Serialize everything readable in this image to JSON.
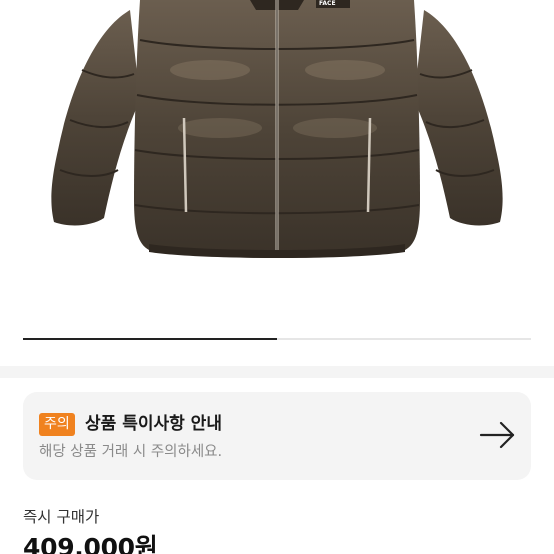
{
  "product": {
    "image_icon": "puffer-jacket-photo",
    "brand_logo_text": "FACE",
    "carousel_progress": 0.5
  },
  "notice": {
    "badge": "주의",
    "title": "상품 특이사항 안내",
    "description": "해당 상품 거래 시 주의하세요.",
    "arrow_icon": "arrow-right-icon",
    "badge_color": "#f0821f"
  },
  "price": {
    "label": "즉시 구매가",
    "value": "409,000원"
  }
}
